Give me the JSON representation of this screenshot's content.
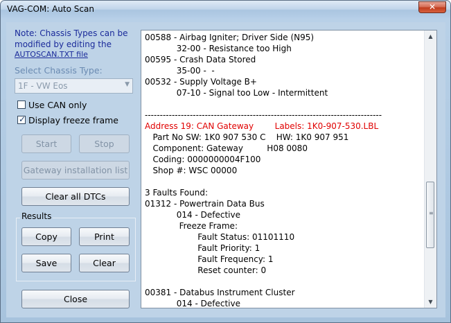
{
  "window": {
    "title": "VAG-COM:  Auto Scan",
    "close_glyph": "✕"
  },
  "sidebar": {
    "note_text": "Note:  Chassis Types can be modified by editing the",
    "note_link": "AUTOSCAN.TXT file",
    "chassis_label": "Select Chassis Type:",
    "chassis_value": "1F - VW Eos",
    "use_can_label": "Use CAN only",
    "use_can_checked": false,
    "freeze_frame_label": "Display freeze frame",
    "freeze_frame_checked": true,
    "start_label": "Start",
    "stop_label": "Stop",
    "gateway_label": "Gateway installation list",
    "clear_all_label": "Clear all DTCs",
    "results_label": "Results",
    "copy_label": "Copy",
    "print_label": "Print",
    "save_label": "Save",
    "clear_label": "Clear",
    "close_label": "Close"
  },
  "log": {
    "lines": [
      "00588 - Airbag Igniter; Driver Side (N95)",
      "            32-00 - Resistance too High",
      "00595 - Crash Data Stored",
      "            35-00 -  -",
      "00532 - Supply Voltage B+",
      "            07-10 - Signal too Low - Intermittent",
      "",
      "-------------------------------------------------------------------------------",
      "Address 19: CAN Gateway        Labels: 1K0-907-530.LBL",
      "   Part No SW: 1K0 907 530 C    HW: 1K0 907 951",
      "   Component: Gateway         H08 0080",
      "   Coding: 0000000004F100",
      "   Shop #: WSC 00000",
      "",
      "3 Faults Found:",
      "01312 - Powertrain Data Bus",
      "            014 - Defective",
      "             Freeze Frame:",
      "                    Fault Status: 01101110",
      "                    Fault Priority: 1",
      "                    Fault Frequency: 1",
      "                    Reset counter: 0",
      "",
      "00381 - Databus Instrument Cluster",
      "            014 - Defective"
    ],
    "red_line_index": 8
  }
}
